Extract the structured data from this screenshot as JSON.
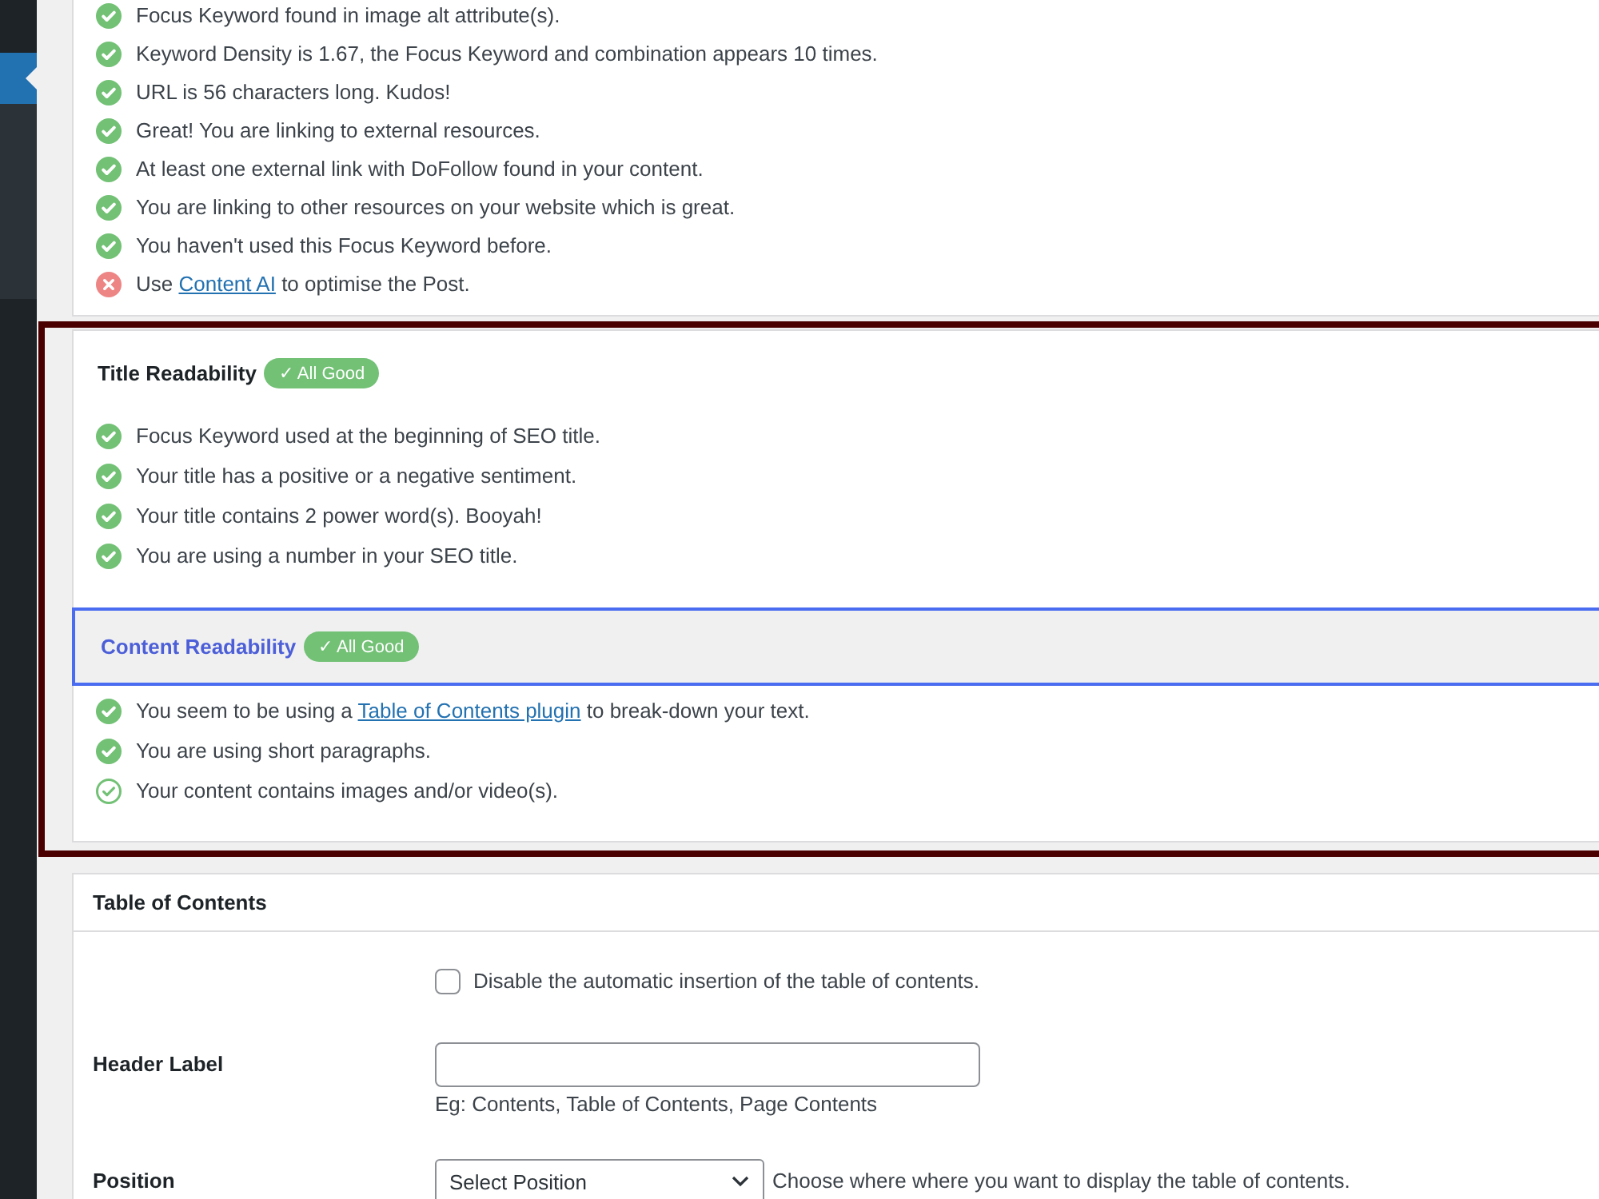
{
  "seo_checks": {
    "items": [
      {
        "kind": "pass",
        "text": "Focus Keyword found in image alt attribute(s)."
      },
      {
        "kind": "pass",
        "text": "Keyword Density is 1.67, the Focus Keyword and combination appears 10 times."
      },
      {
        "kind": "pass",
        "text": "URL is 56 characters long. Kudos!"
      },
      {
        "kind": "pass",
        "text": "Great! You are linking to external resources."
      },
      {
        "kind": "pass",
        "text": "At least one external link with DoFollow found in your content."
      },
      {
        "kind": "pass",
        "text": "You are linking to other resources on your website which is great."
      },
      {
        "kind": "pass",
        "text": "You haven't used this Focus Keyword before."
      },
      {
        "kind": "fail",
        "text": "Use ",
        "link": "Content AI",
        "text_after": " to optimise the Post."
      }
    ]
  },
  "sections": [
    {
      "title": "Title Readability",
      "badge": "✓ All Good",
      "highlighted": false,
      "items": [
        {
          "kind": "pass",
          "text": "Focus Keyword used at the beginning of SEO title."
        },
        {
          "kind": "pass",
          "text": "Your title has a positive or a negative sentiment."
        },
        {
          "kind": "pass",
          "text": "Your title contains 2 power word(s). Booyah!"
        },
        {
          "kind": "pass",
          "text": "You are using a number in your SEO title."
        }
      ]
    },
    {
      "title": "Content Readability",
      "badge": "✓ All Good",
      "highlighted": true,
      "items": [
        {
          "kind": "pass",
          "text": "You seem to be using a ",
          "link": "Table of Contents plugin",
          "text_after": " to break-down your text."
        },
        {
          "kind": "pass",
          "text": "You are using short paragraphs."
        },
        {
          "kind": "hollow",
          "text": "Your content contains images and/or video(s)."
        }
      ]
    }
  ],
  "toc": {
    "title": "Table of Contents",
    "disable_auto": {
      "label": "Disable the automatic insertion of the table of contents.",
      "checked": false
    },
    "header_label": {
      "label": "Header Label",
      "hint": "Eg: Contents, Table of Contents, Page Contents"
    },
    "position": {
      "label": "Position",
      "value": "Select Position",
      "hint": "Choose where where you want to display the table of contents."
    }
  }
}
